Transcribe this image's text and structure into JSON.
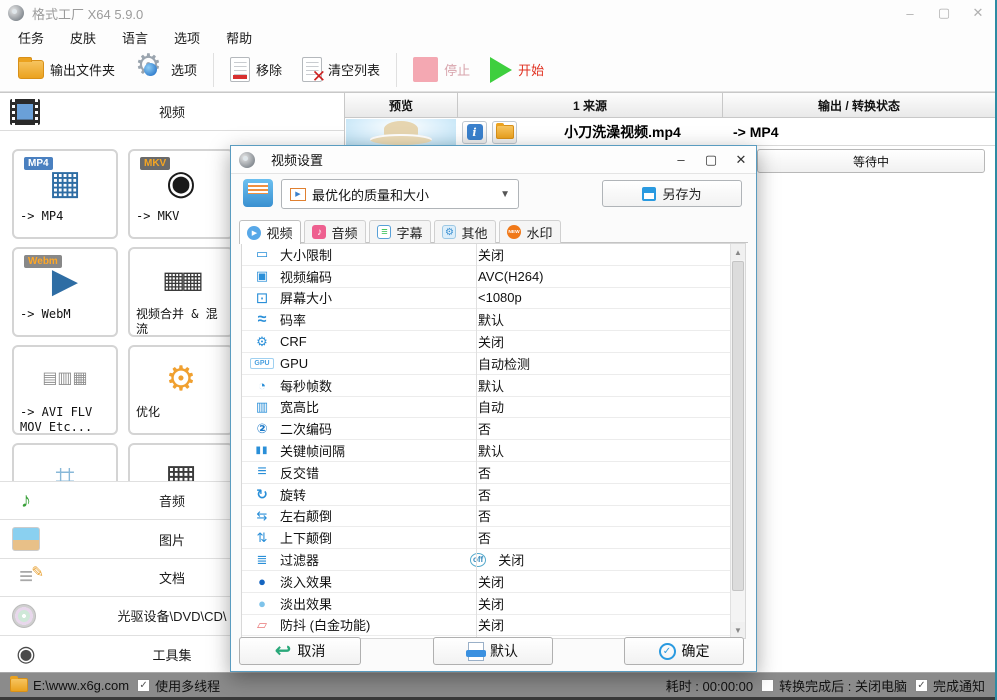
{
  "window": {
    "title": "格式工厂 X64 5.9.0",
    "menu": [
      "任务",
      "皮肤",
      "语言",
      "选项",
      "帮助"
    ]
  },
  "toolbar": {
    "output_folder": "输出文件夹",
    "options": "选项",
    "remove": "移除",
    "clear_list": "清空列表",
    "stop": "停止",
    "start": "开始"
  },
  "sidebar": {
    "section_title": "视频",
    "cards": [
      {
        "badge": "MP4",
        "badge_style": "background:#4a80c0;color:#fff",
        "glyph": "▦",
        "glyph_style": "color:#2e6da4",
        "label": "-> MP4"
      },
      {
        "badge": "MKV",
        "badge_style": "background:#6a6a6a;color:#f5a623",
        "glyph": "◉",
        "glyph_style": "color:#1a1a1a",
        "label": "-> MKV"
      },
      {
        "badge": "Webm",
        "badge_style": "background:#888;color:#ffa726",
        "glyph": "▶",
        "glyph_style": "color:#2e6da4",
        "label": "-> WebM"
      },
      {
        "glyph": "▦▦",
        "glyph_style": "color:#3a3a3a;font-size:24px;letter-spacing:-4px",
        "label": "视频合并 & 混流"
      },
      {
        "glyph": "▤▥▦",
        "glyph_style": "color:#909090;font-size:16px",
        "label": "-> AVI FLV MOV Etc..."
      },
      {
        "glyph": "⚙",
        "glyph_style": "color:#f0a030",
        "label": "优化"
      },
      {
        "glyph": "⌗",
        "glyph_style": "color:#88b8d8",
        "label": ""
      },
      {
        "glyph": "▦",
        "glyph_style": "color:#3a3a3a",
        "label": ""
      }
    ],
    "categories": [
      {
        "label": "音频",
        "icon": "audio-cat-icon"
      },
      {
        "label": "图片",
        "icon": "picture-cat-icon"
      },
      {
        "label": "文档",
        "icon": "document-cat-icon"
      },
      {
        "label": "光驱设备\\DVD\\CD\\",
        "icon": "disc-cat-icon"
      },
      {
        "label": "工具集",
        "icon": "toolset-cat-icon"
      }
    ]
  },
  "queue": {
    "headers": [
      "预览",
      "1 来源",
      "输出 / 转换状态"
    ],
    "row": {
      "filename": "小刀洗澡视频.mp4",
      "output": "-> MP4",
      "status": "等待中"
    }
  },
  "dialog": {
    "title": "视频设置",
    "profile": "最优化的质量和大小",
    "save_as": "另存为",
    "tabs": [
      {
        "label": "视频",
        "icon": "video-tab-icon",
        "active": "true"
      },
      {
        "label": "音频",
        "icon": "audio-tab-icon",
        "active": "false"
      },
      {
        "label": "字幕",
        "icon": "subtitle-tab-icon",
        "active": "false"
      },
      {
        "label": "其他",
        "icon": "other-tab-icon",
        "active": "false"
      },
      {
        "label": "水印",
        "icon": "watermark-tab-icon",
        "active": "false"
      }
    ],
    "settings": [
      {
        "name": "大小限制",
        "value": "关闭",
        "glyph": "▭",
        "istyle": "color:#2a8fd8"
      },
      {
        "name": "视频编码",
        "value": "AVC(H264)",
        "glyph": "▣",
        "istyle": "color:#2a8fd8"
      },
      {
        "name": "屏幕大小",
        "value": "<1080p",
        "glyph": "⊡",
        "istyle": "color:#2a8fd8;font-size:15px"
      },
      {
        "name": "码率",
        "value": "默认",
        "glyph": "≈",
        "istyle": "color:#2a8fd8;font-size:16px;font-weight:bold"
      },
      {
        "name": "CRF",
        "value": "关闭",
        "glyph": "⚙",
        "istyle": "color:#2a8fd8"
      },
      {
        "name": "GPU",
        "value": "自动检测",
        "glyph": "GPU",
        "istyle": "color:#4aa0e0;font-size:7px;font-weight:bold;border:1px solid #9fd0f0;border-radius:2px;padding:1px 1px"
      },
      {
        "name": "每秒帧数",
        "value": "默认",
        "glyph": "◔",
        "istyle": "color:#2a8fd8"
      },
      {
        "name": "宽高比",
        "value": "自动",
        "glyph": "▥",
        "istyle": "color:#2a8fd8"
      },
      {
        "name": "二次编码",
        "value": "否",
        "glyph": "②",
        "istyle": "color:#1a78c8;font-weight:bold"
      },
      {
        "name": "关键帧间隔",
        "value": "默认",
        "glyph": "▮▮",
        "istyle": "color:#2a8fd8;font-size:10px;letter-spacing:1px"
      },
      {
        "name": "反交错",
        "value": "否",
        "glyph": "≡",
        "istyle": "color:#2a8fd8;font-size:16px"
      },
      {
        "name": "旋转",
        "value": "否",
        "glyph": "↻",
        "istyle": "color:#2a8fd8;font-weight:bold;font-size:14px"
      },
      {
        "name": "左右颠倒",
        "value": "否",
        "glyph": "⇆",
        "istyle": "color:#2a8fd8"
      },
      {
        "name": "上下颠倒",
        "value": "否",
        "glyph": "⇅",
        "istyle": "color:#2a8fd8"
      },
      {
        "name": "过滤器",
        "value": "关闭",
        "glyph": "≣",
        "istyle": "color:#2a8fd8",
        "badge": "off"
      },
      {
        "name": "淡入效果",
        "value": "关闭",
        "glyph": "●",
        "istyle": "color:#1565c0"
      },
      {
        "name": "淡出效果",
        "value": "关闭",
        "glyph": "●",
        "istyle": "color:#7ec3ea"
      },
      {
        "name": "防抖 (白金功能)",
        "value": "关闭",
        "glyph": "▱",
        "istyle": "color:#e87878;font-weight:bold"
      }
    ],
    "buttons": {
      "cancel": "取消",
      "default": "默认",
      "ok": "确定"
    }
  },
  "statusbar": {
    "output_path": "E:\\www.x6g.com",
    "multithread": "使用多线程",
    "elapsed": "耗时 : 00:00:00",
    "shutdown_after": "转换完成后 : 关闭电脑",
    "notify": "完成通知"
  }
}
